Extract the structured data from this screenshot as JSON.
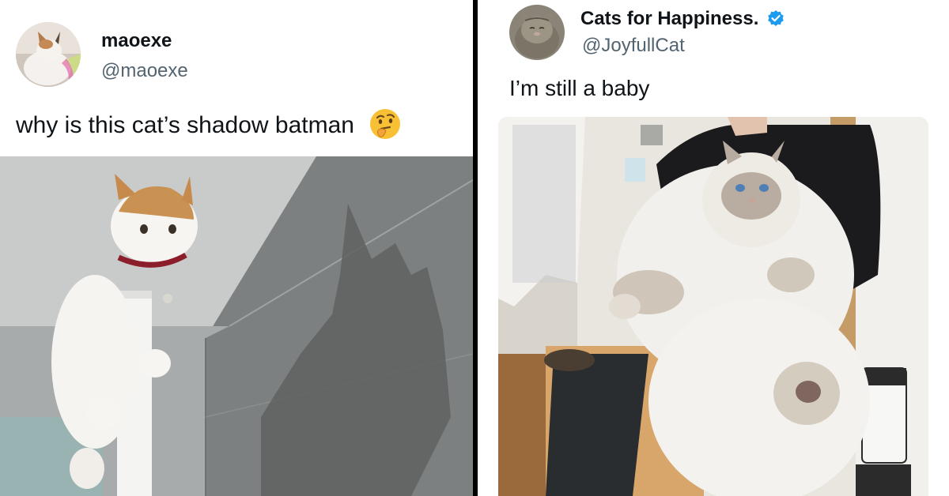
{
  "left_tweet": {
    "display_name": "maoexe",
    "handle": "@maoexe",
    "text": "why is this cat’s shadow batman",
    "emoji": "thinking-face-emoji"
  },
  "right_tweet": {
    "display_name": "Cats for Happiness.",
    "handle": "@JoyfullCat",
    "text": "I’m still a baby",
    "verified": true
  },
  "colors": {
    "name": "#0f1419",
    "handle": "#536471",
    "verified_badge": "#1d9bf0",
    "divider": "#000000"
  }
}
